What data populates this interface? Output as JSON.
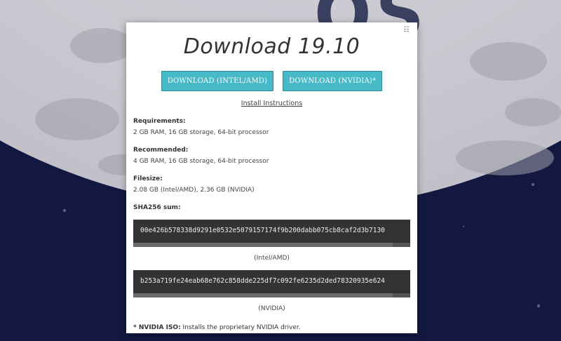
{
  "background": {
    "logo_text": "OS",
    "colors": {
      "space": "#121840",
      "moon": "#c9c7cf",
      "accent": "#48b9c7"
    }
  },
  "modal": {
    "close_icon": "close-icon",
    "title": "Download 19.10",
    "buttons": {
      "intel_label": "DOWNLOAD (INTEL/AMD)",
      "nvidia_label": "DOWNLOAD (NVIDIA)*"
    },
    "install_link": "Install Instructions",
    "requirements": {
      "label": "Requirements:",
      "value": "2 GB RAM, 16 GB storage, 64-bit processor"
    },
    "recommended": {
      "label": "Recommended:",
      "value": "4 GB RAM, 16 GB storage, 64-bit processor"
    },
    "filesize": {
      "label": "Filesize:",
      "value": "2.08 GB (Intel/AMD), 2.36 GB (NVIDIA)"
    },
    "sha": {
      "label": "SHA256 sum:",
      "intel": {
        "hash": "00e426b578338d9291e0532e5079157174f9b200dabb075cb8caf2d3b7130",
        "caption": "(Intel/AMD)"
      },
      "nvidia": {
        "hash": "b253a719fe24eab68e762c858dde225df7c092fe6235d2ded78320935e624",
        "caption": "(NVIDIA)"
      }
    },
    "note": {
      "prefix": "* NVIDIA ISO:",
      "text": " Installs the proprietary NVIDIA driver."
    }
  }
}
